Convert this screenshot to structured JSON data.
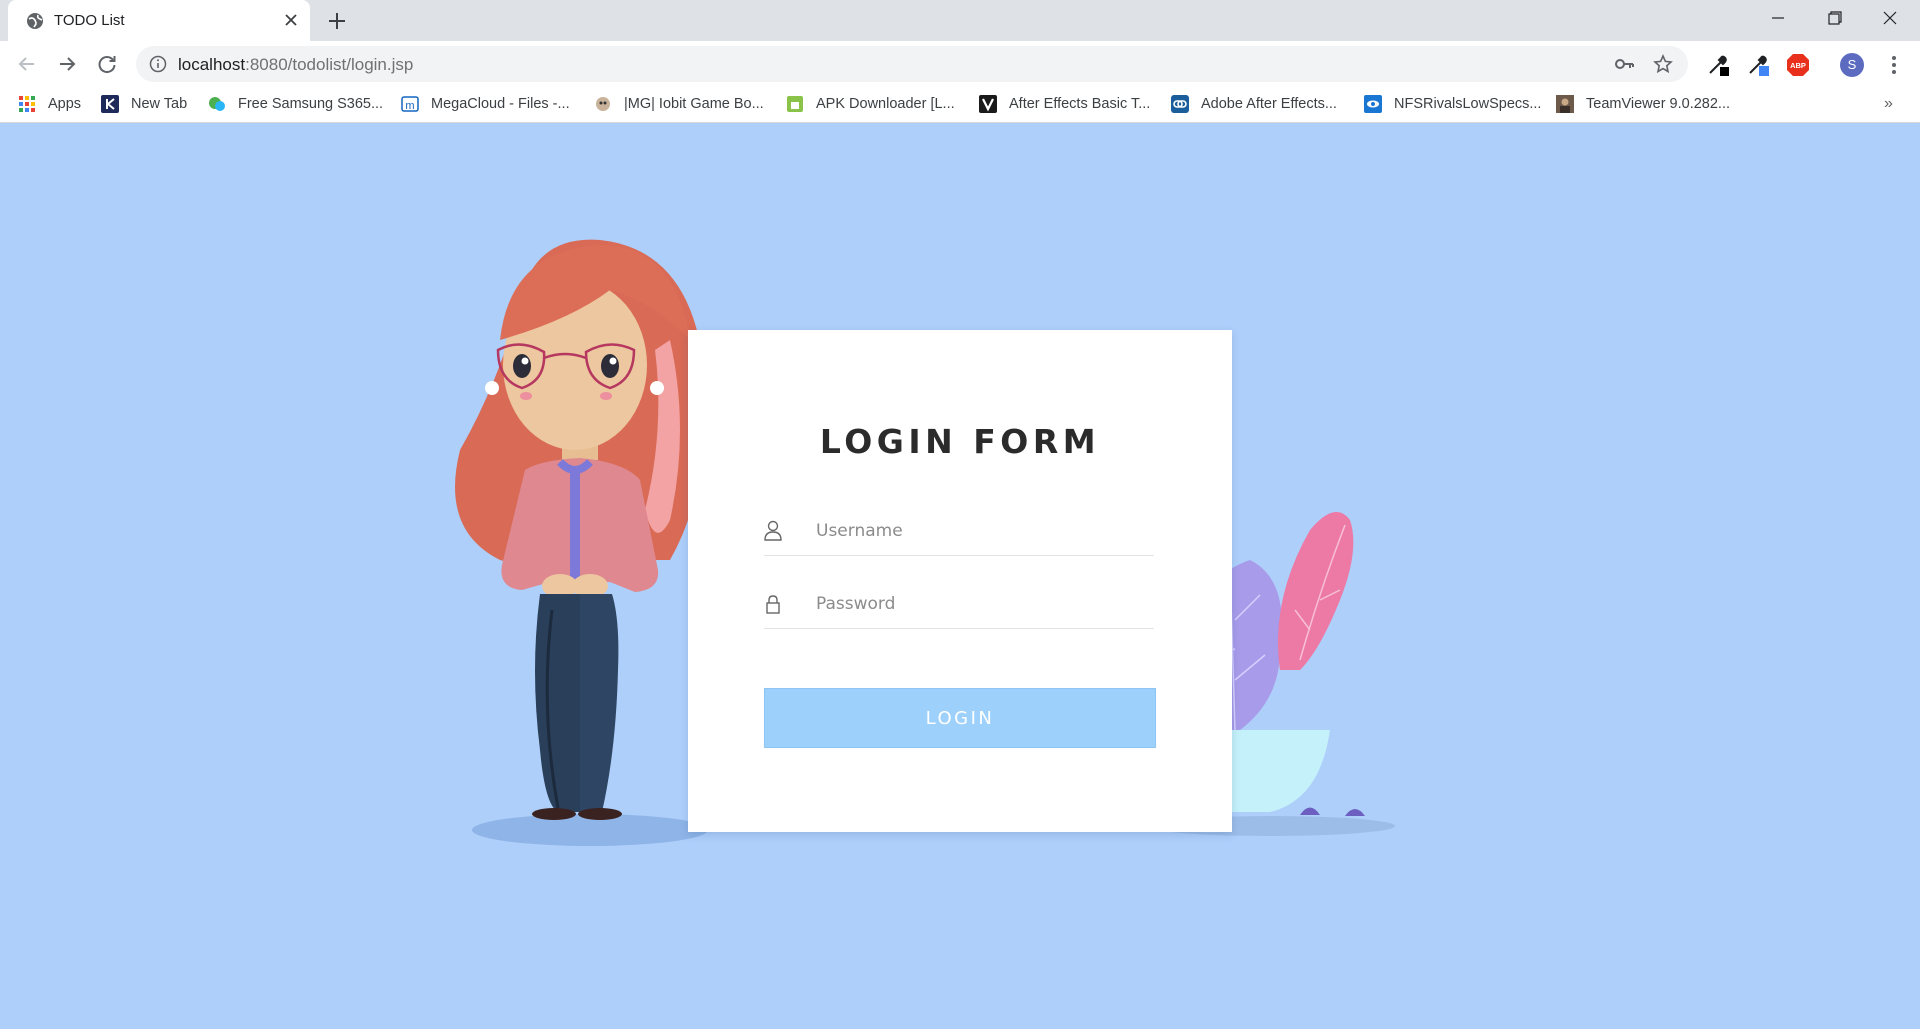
{
  "browser": {
    "tab_title": "TODO List",
    "url_host": "localhost",
    "url_rest": ":8080/todolist/login.jsp",
    "profile_initial": "S",
    "bookmarks": [
      {
        "label": "Apps",
        "icon": "apps-grid-icon"
      },
      {
        "label": "New Tab",
        "icon": "k-logo-icon"
      },
      {
        "label": "Free Samsung S365...",
        "icon": "chat-bubble-icon"
      },
      {
        "label": "MegaCloud - Files -...",
        "icon": "megacloud-icon"
      },
      {
        "label": "|MG| Iobit Game Bo...",
        "icon": "game-icon"
      },
      {
        "label": "APK Downloader [L...",
        "icon": "android-icon"
      },
      {
        "label": "After Effects Basic T...",
        "icon": "v-logo-icon"
      },
      {
        "label": "Adobe After Effects...",
        "icon": "link-icon"
      },
      {
        "label": "NFSRivalsLowSpecs...",
        "icon": "eye-logo-icon"
      },
      {
        "label": "TeamViewer 9.0.282...",
        "icon": "photo-icon"
      }
    ],
    "more_bookmarks": "»"
  },
  "login": {
    "title": "LOGIN FORM",
    "username_placeholder": "Username",
    "password_placeholder": "Password",
    "button_label": "LOGIN"
  },
  "colors": {
    "page_background": "#aecffa",
    "button_background": "#9dd0fb",
    "card_background": "#ffffff"
  }
}
